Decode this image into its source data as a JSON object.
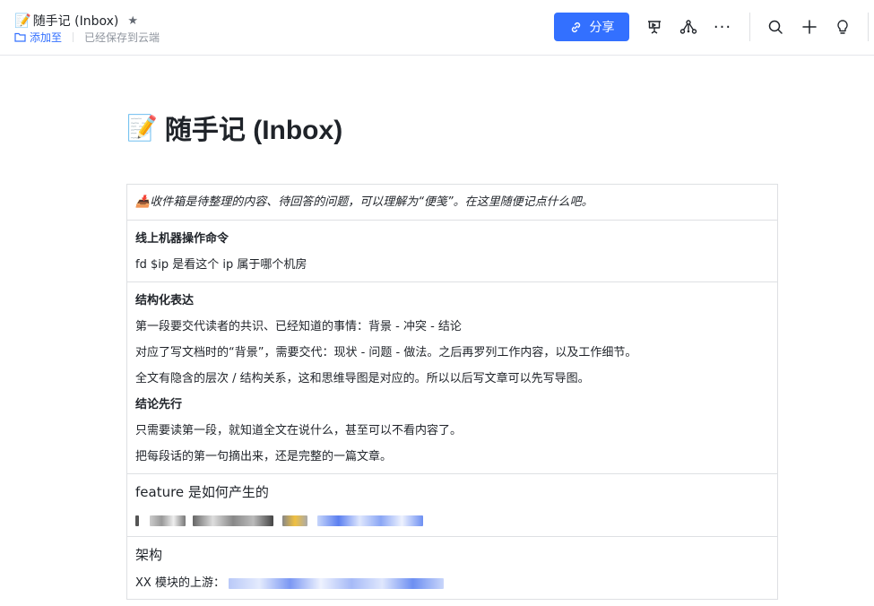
{
  "header": {
    "doc_emoji": "📝",
    "doc_title": "随手记 (Inbox)",
    "add_to_label": "添加至",
    "saved_status": "已经保存到云端",
    "share_label": "分享",
    "more_label": "···"
  },
  "icons": {
    "star": "star-icon",
    "folder": "folder-icon",
    "link": "link-icon",
    "present": "presentation-icon",
    "mindmap": "mindmap-icon",
    "more": "more-icon",
    "search": "search-icon",
    "add": "plus-icon",
    "idea": "lightbulb-icon"
  },
  "colors": {
    "accent": "#3370ff",
    "text": "#1f2329",
    "muted": "#8f959e",
    "border": "#dee0e3"
  },
  "page": {
    "emoji": "📝",
    "title": "随手记 (Inbox)"
  },
  "table": {
    "intro_emoji": "📥",
    "intro": "收件箱是待整理的内容、待回答的问题，可以理解为“便笺”。在这里随便记点什么吧。",
    "ops": {
      "heading": "线上机器操作命令",
      "text": "fd $ip 是看这个 ip 属于哪个机房"
    },
    "structured": {
      "heading": "结构化表达",
      "line1": "第一段要交代读者的共识、已经知道的事情：背景 - 冲突 - 结论",
      "line2": "对应了写文档时的“背景”，需要交代：现状 - 问题 - 做法。之后再罗列工作内容，以及工作细节。",
      "line3": "全文有隐含的层次 / 结构关系，这和思维导图是对应的。所以以后写文章可以先写导图。",
      "heading2": "结论先行",
      "line4": "只需要读第一段，就知道全文在说什么，甚至可以不看内容了。",
      "line5": "把每段话的第一句摘出来，还是完整的一篇文章。"
    },
    "feature": {
      "heading": "feature 是如何产生的"
    },
    "arch": {
      "heading": "架构",
      "text": "XX 模块的上游："
    }
  }
}
